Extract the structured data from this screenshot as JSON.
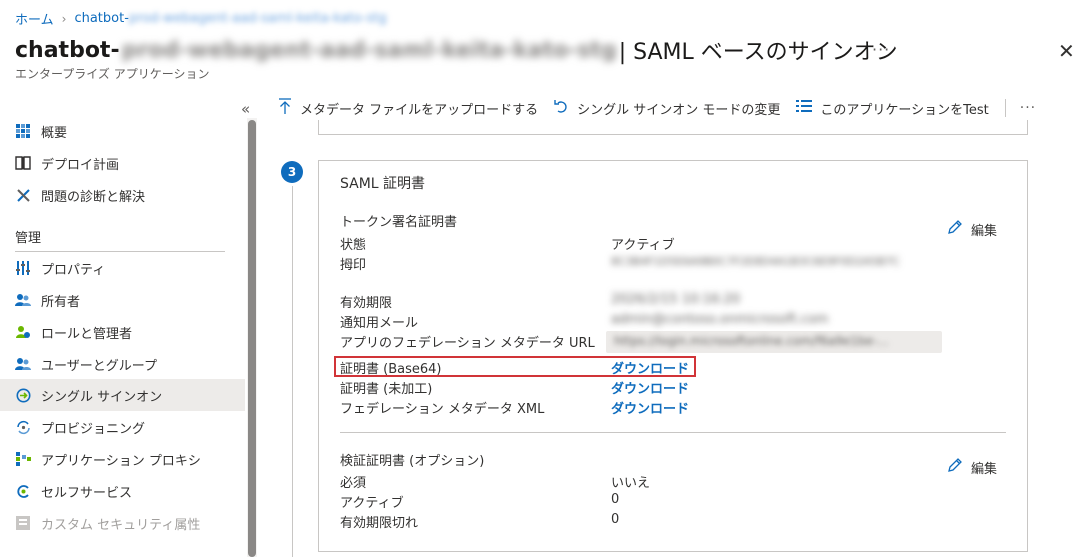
{
  "breadcrumb": {
    "home": "ホーム",
    "current_prefix": "chatbot-",
    "current_obscured": "prod-webagent-aad-saml-keita-kato-stg"
  },
  "header": {
    "title_app": "chatbot-",
    "title_obscured": "prod-webagent-aad-saml-keita-kato-stg",
    "title_suffix": "| SAML ベースのサインオン",
    "subtitle": "エンタープライズ アプリケーション",
    "more": "···",
    "close": "✕"
  },
  "sidebar": {
    "collapse": "«",
    "items_top": [
      {
        "label": "概要",
        "icon": "grid-icon"
      },
      {
        "label": "デプロイ計画",
        "icon": "book-icon"
      },
      {
        "label": "問題の診断と解決",
        "icon": "wrench-icon"
      }
    ],
    "section_header": "管理",
    "items_manage": [
      {
        "label": "プロパティ",
        "icon": "properties-icon"
      },
      {
        "label": "所有者",
        "icon": "owners-icon"
      },
      {
        "label": "ロールと管理者",
        "icon": "roles-icon"
      },
      {
        "label": "ユーザーとグループ",
        "icon": "users-groups-icon"
      },
      {
        "label": "シングル サインオン",
        "icon": "sso-icon",
        "active": true
      },
      {
        "label": "プロビジョニング",
        "icon": "provisioning-icon"
      },
      {
        "label": "アプリケーション プロキシ",
        "icon": "proxy-icon"
      },
      {
        "label": "セルフサービス",
        "icon": "self-service-icon"
      },
      {
        "label": "カスタム セキュリティ属性",
        "icon": "security-attributes-icon",
        "disabled": true
      }
    ]
  },
  "toolbar": {
    "upload": "メタデータ ファイルをアップロードする",
    "change_mode": "シングル サインオン モードの変更",
    "test": "このアプリケーションをTest",
    "more": "···"
  },
  "card": {
    "step_number": "3",
    "title": "SAML 証明書",
    "token_section": {
      "heading": "トークン署名証明書",
      "edit": "編集",
      "rows": [
        {
          "label": "状態",
          "value": "アクティブ"
        },
        {
          "label": "拇印",
          "value": "8C3B4F1D5E6A9B0C7F2E8D4A1B3C6E9F0D2A5B7C"
        },
        {
          "label": "有効期限",
          "value": "2026/2/15 10:16:20"
        },
        {
          "label": "通知用メール",
          "value": "admin@contoso.onmicrosoft.com"
        },
        {
          "label": "アプリのフェデレーション メタデータ URL",
          "value": "https://login.microsoftonline.com/f6a9e1be-..."
        }
      ],
      "downloads": [
        {
          "label": "証明書 (Base64)",
          "link": "ダウンロード"
        },
        {
          "label": "証明書 (未加工)",
          "link": "ダウンロード"
        },
        {
          "label": "フェデレーション メタデータ XML",
          "link": "ダウンロード"
        }
      ]
    },
    "verify_section": {
      "heading": "検証証明書 (オプション)",
      "edit": "編集",
      "rows": [
        {
          "label": "必須",
          "value": "いいえ"
        },
        {
          "label": "アクティブ",
          "value": "0"
        },
        {
          "label": "有効期限切れ",
          "value": "0"
        }
      ]
    }
  },
  "colors": {
    "accent": "#0f6cbd",
    "highlight": "#d13438",
    "active_nav": "#edebe9"
  }
}
